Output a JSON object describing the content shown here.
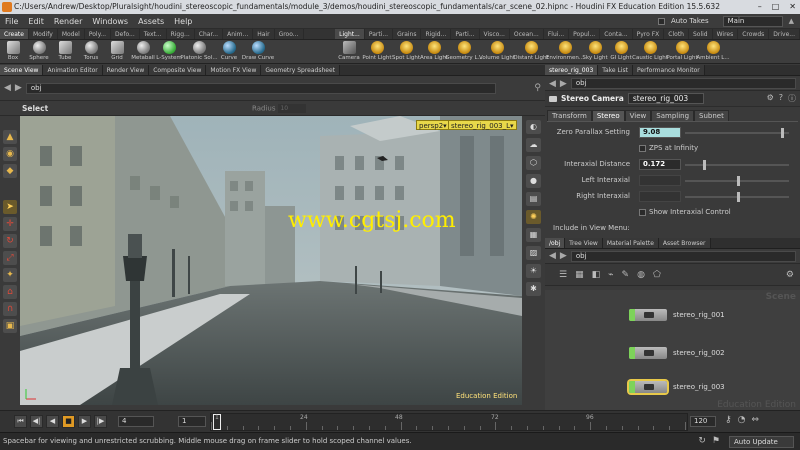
{
  "window": {
    "title": "C:/Users/Andrew/Desktop/Pluralsight/houdini_stereoscopic_fundamentals/module_3/demos/houdini_stereoscopic_fundamentals/car_scene_02.hipnc - Houdini FX Education Edition 15.5.632",
    "controls": [
      "–",
      "□",
      "✕"
    ]
  },
  "menubar": {
    "items": [
      "File",
      "Edit",
      "Render",
      "Windows",
      "Assets",
      "Help"
    ],
    "auto_takes_label": "Auto Takes",
    "desktop": "Main"
  },
  "shelf": {
    "tabs_left": [
      "Create",
      "Modify",
      "Model",
      "Poly...",
      "Defo...",
      "Text...",
      "Rigg...",
      "Char...",
      "Anim...",
      "Hair",
      "Groo..."
    ],
    "tabs_right": [
      "Light...",
      "Parti...",
      "Grains",
      "Rigid...",
      "Parti...",
      "Visco...",
      "Ocean...",
      "Flui...",
      "Popul...",
      "Conta...",
      "Pyro FX",
      "Cloth",
      "Solid",
      "Wires",
      "Crowds",
      "Drive..."
    ],
    "tools_left": [
      "Box",
      "Sphere",
      "Tube",
      "Torus",
      "Grid",
      "Metaball",
      "L-System",
      "Platonic Sol...",
      "Curve",
      "Draw Curve"
    ],
    "tools_right": [
      "Camera",
      "Point Light",
      "Spot Light",
      "Area Light",
      "Geometry L...",
      "Volume Light",
      "Distant Light",
      "Environmen...",
      "Sky Light",
      "GI Light",
      "Caustic Light",
      "Portal Light",
      "Ambient L..."
    ]
  },
  "left_panel": {
    "tabs": [
      "Scene View",
      "Animation Editor",
      "Render View",
      "Composite View",
      "Motion FX View",
      "Geometry Spreadsheet"
    ],
    "path": "obj",
    "select_label": "Select",
    "radius_label": "Radius",
    "radius_value": "10",
    "viewport": {
      "persp_label": "persp2▾",
      "camera_label": "stereo_rig_003_L▾",
      "watermark": "www.cgtsj.com",
      "edition": "Education Edition"
    }
  },
  "params_panel": {
    "tabs": [
      "stereo_rig_003",
      "Take List",
      "Performance Monitor"
    ],
    "path": "obj",
    "node_type": "Stereo Camera",
    "node_name": "stereo_rig_003",
    "param_tabs": [
      "Transform",
      "Stereo",
      "View",
      "Sampling",
      "Subnet"
    ],
    "active_param_tab": "Stereo",
    "rows": {
      "zero_parallax": {
        "label": "Zero Parallax Setting",
        "value": "9.08"
      },
      "zps_infinity": {
        "label": "ZPS at Infinity"
      },
      "interaxial": {
        "label": "Interaxial Distance",
        "value": "0.172"
      },
      "left_interaxial": {
        "label": "Left Interaxial"
      },
      "right_interaxial": {
        "label": "Right Interaxial",
        "checkbox_label": "Show Interaxial Control"
      },
      "include_view": {
        "label": "Include in View Menu:"
      }
    }
  },
  "network_panel": {
    "tabs": [
      "/obj",
      "Tree View",
      "Material Palette",
      "Asset Browser"
    ],
    "path": "obj",
    "corner_label": "Scene",
    "nodes": [
      "stereo_rig_001",
      "stereo_rig_002",
      "stereo_rig_003"
    ],
    "edition": "Education Edition"
  },
  "playbar": {
    "start_frame": "4",
    "current_frame": "1",
    "end_frame": "120",
    "ticks": [
      "1",
      "24",
      "48",
      "72",
      "96"
    ],
    "end_tick": "120"
  },
  "statusbar": {
    "message": "Spacebar for viewing and unrestricted scrubbing. Middle mouse drag on frame slider to hold scoped channel values.",
    "auto_update": "Auto Update"
  }
}
